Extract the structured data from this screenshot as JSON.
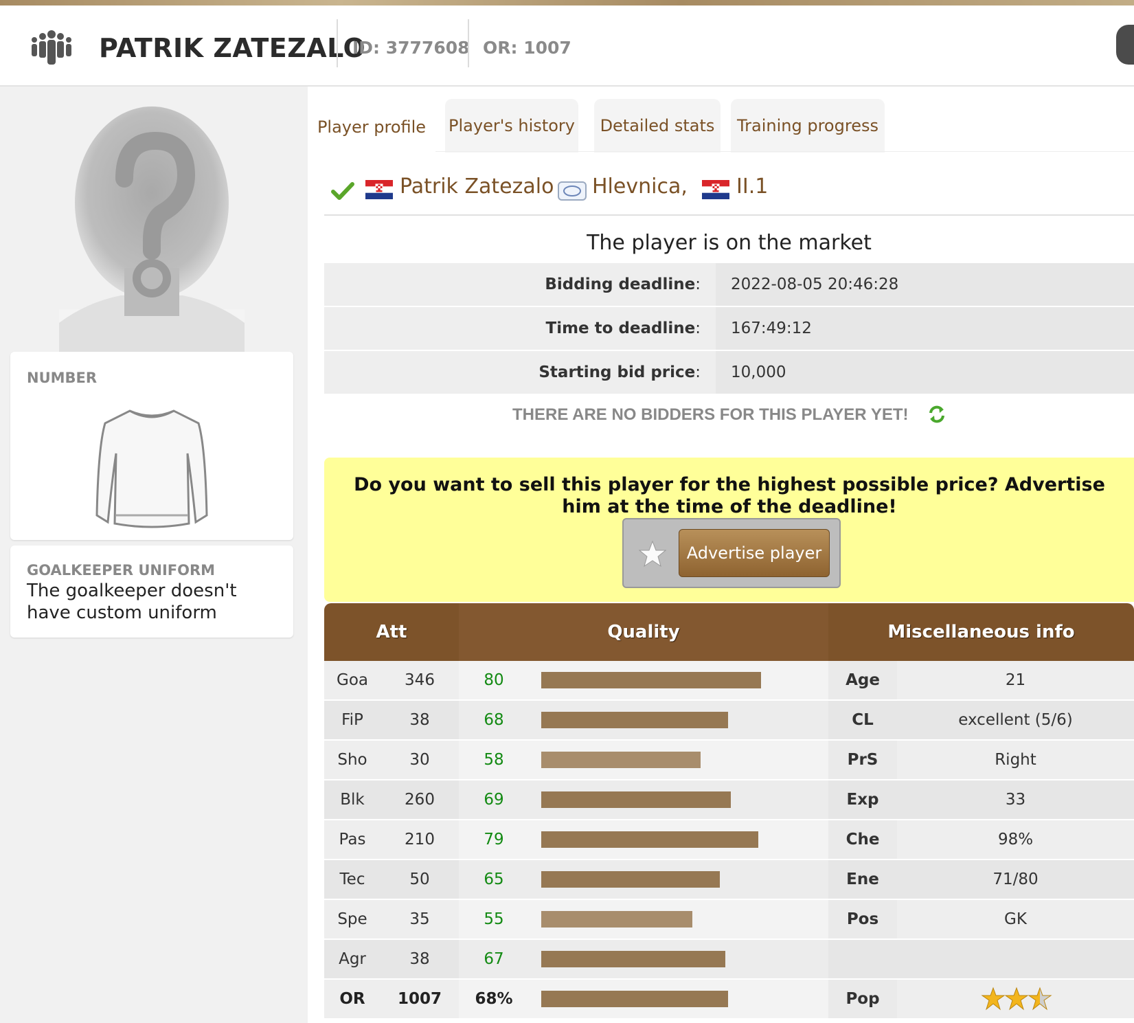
{
  "header": {
    "name": "PATRIK ZATEZALO",
    "id_label": "ID: 3777608",
    "or_label": "OR: 1007"
  },
  "sidebar": {
    "number_label": "NUMBER",
    "uniform_label": "GOALKEEPER UNIFORM",
    "uniform_text": "The goalkeeper doesn't have custom uniform"
  },
  "tabs": [
    {
      "label": "Player profile",
      "active": true
    },
    {
      "label": "Player's history",
      "active": false
    },
    {
      "label": "Detailed stats",
      "active": false
    },
    {
      "label": "Training progress",
      "active": false
    }
  ],
  "player_line": {
    "name": "Patrik Zatezalo",
    "team": "Hlevnica,",
    "league": "II.1"
  },
  "market": {
    "title": "The player is on the market",
    "rows": [
      {
        "label": "Bidding deadline",
        "value": "2022-08-05 20:46:28"
      },
      {
        "label": "Time to deadline",
        "value": "167:49:12"
      },
      {
        "label": "Starting bid price",
        "value": "10,000"
      }
    ],
    "no_bidders": "THERE ARE NO BIDDERS FOR THIS PLAYER YET!"
  },
  "promo": {
    "text": "Do you want to sell this player for the highest possible price? Advertise him at the time of the deadline!",
    "button": "Advertise player"
  },
  "stats": {
    "headers": {
      "att": "Att",
      "quality": "Quality",
      "misc": "Miscellaneous info"
    },
    "rows": [
      {
        "att": "Goa",
        "value": "346",
        "quality": "80",
        "misc_key": "Age",
        "misc_val": "21"
      },
      {
        "att": "FiP",
        "value": "38",
        "quality": "68",
        "misc_key": "CL",
        "misc_val": "excellent (5/6)"
      },
      {
        "att": "Sho",
        "value": "30",
        "quality": "58",
        "misc_key": "PrS",
        "misc_val": "Right"
      },
      {
        "att": "Blk",
        "value": "260",
        "quality": "69",
        "misc_key": "Exp",
        "misc_val": "33"
      },
      {
        "att": "Pas",
        "value": "210",
        "quality": "79",
        "misc_key": "Che",
        "misc_val": "98%"
      },
      {
        "att": "Tec",
        "value": "50",
        "quality": "65",
        "misc_key": "Ene",
        "misc_val": "71/80"
      },
      {
        "att": "Spe",
        "value": "35",
        "quality": "55",
        "misc_key": "Pos",
        "misc_val": "GK"
      },
      {
        "att": "Agr",
        "value": "38",
        "quality": "67",
        "misc_key": "",
        "misc_val": ""
      },
      {
        "att": "OR",
        "value": "1007",
        "quality": "68%",
        "misc_key": "Pop",
        "misc_val": ""
      }
    ],
    "popularity_stars": 2.5,
    "bar_colors": {
      "dark": "#967853",
      "light": "#a88d6c"
    }
  },
  "icons": {
    "header": "team-people-icon",
    "check": "check-icon",
    "flag": "croatia-flag-icon",
    "club": "club-badge-icon",
    "refresh": "refresh-icon",
    "star": "star-icon"
  }
}
